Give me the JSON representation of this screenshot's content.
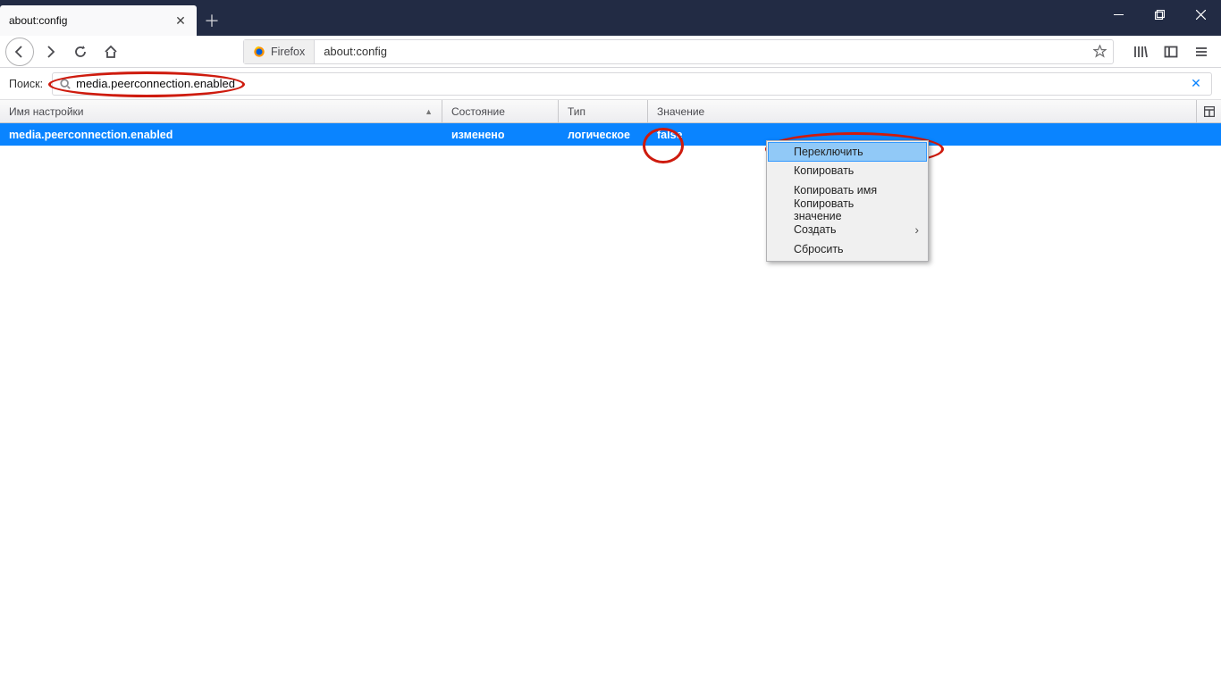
{
  "window": {
    "tab_title": "about:config"
  },
  "nav": {
    "identity_label": "Firefox",
    "url": "about:config"
  },
  "search": {
    "label": "Поиск:",
    "value": "media.peerconnection.enabled"
  },
  "columns": {
    "name": "Имя настройки",
    "status": "Состояние",
    "type": "Тип",
    "value": "Значение"
  },
  "row": {
    "name": "media.peerconnection.enabled",
    "status": "изменено",
    "type": "логическое",
    "value": "false"
  },
  "context_menu": {
    "toggle": "Переключить",
    "copy": "Копировать",
    "copy_name": "Копировать имя",
    "copy_value": "Копировать значение",
    "create": "Создать",
    "reset": "Сбросить"
  }
}
